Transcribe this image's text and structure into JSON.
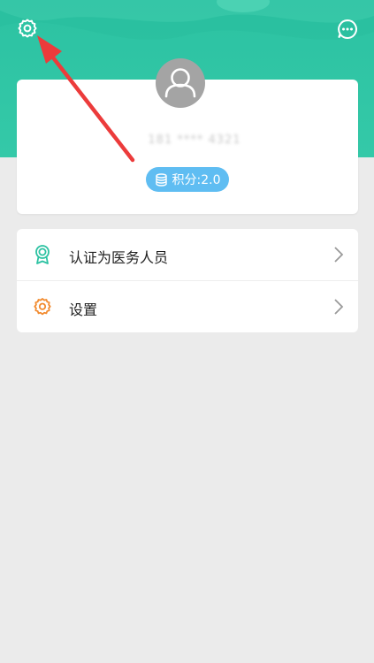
{
  "header": {
    "settings_icon": "gear-icon",
    "message_icon": "chat-bubble-icon",
    "bg_color": "#2cc2a2"
  },
  "profile": {
    "avatar_icon": "user-avatar-icon",
    "username": "181 **** 4321",
    "points_icon": "database-icon",
    "points_label": "积分:2.0"
  },
  "menu": {
    "items": [
      {
        "label": "认证为医务人员",
        "icon": "medal-badge-icon",
        "icon_color": "#2cc2a2"
      },
      {
        "label": "设置",
        "icon": "gear-icon",
        "icon_color": "#f28a2e"
      }
    ]
  },
  "annotation": {
    "arrow_color": "#ec3b3b"
  }
}
